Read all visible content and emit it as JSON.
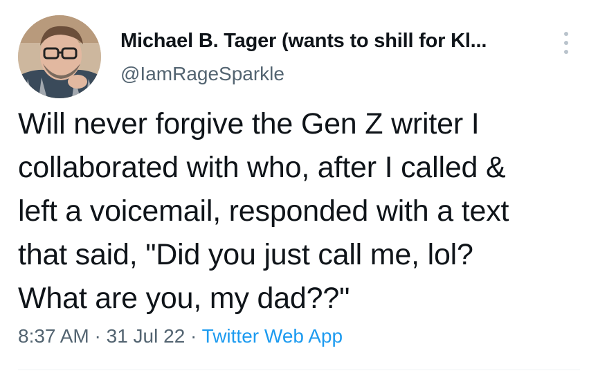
{
  "author": {
    "display_name": "Michael B. Tager (wants to shill for Kl...",
    "handle": "@IamRageSparkle"
  },
  "tweet": {
    "text": "Will never forgive the Gen Z writer I\ncollaborated with who, after I called &\nleft a voicemail, responded with a text\nthat said, \"Did you just call me, lol?\nWhat are you, my dad??\"",
    "time": "8:37 AM",
    "separator": "·",
    "date": "31 Jul 22",
    "source": "Twitter Web App"
  },
  "icons": {
    "more": "more-vertical-icon",
    "avatar": "profile-photo"
  },
  "colors": {
    "text": "#0f1419",
    "secondary": "#536471",
    "link": "#1d9bf0"
  }
}
